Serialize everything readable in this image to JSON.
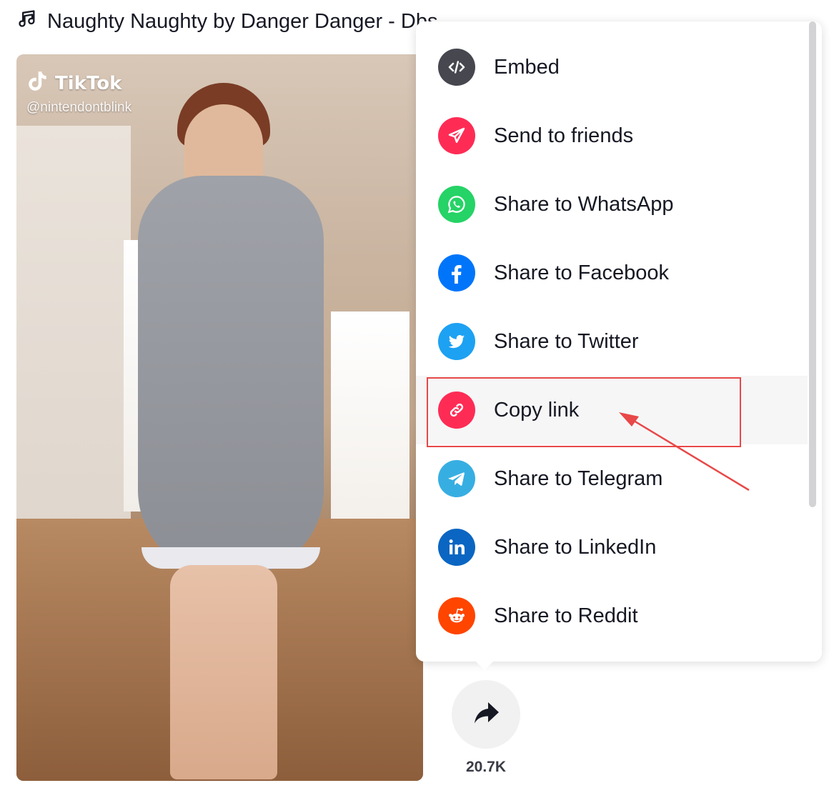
{
  "music": {
    "icon": "music-note-icon",
    "title": "Naughty Naughty by Danger Danger - Dbs"
  },
  "video": {
    "brand_name": "TikTok",
    "handle": "@nintendontblink"
  },
  "share_menu": {
    "items": [
      {
        "label": "Embed",
        "icon": "embed-icon",
        "color": "#46474f"
      },
      {
        "label": "Send to friends",
        "icon": "send-icon",
        "color": "#fe2c55"
      },
      {
        "label": "Share to WhatsApp",
        "icon": "whatsapp-icon",
        "color": "#25d366"
      },
      {
        "label": "Share to Facebook",
        "icon": "facebook-icon",
        "color": "#0075fa"
      },
      {
        "label": "Share to Twitter",
        "icon": "twitter-icon",
        "color": "#1da1f2"
      },
      {
        "label": "Copy link",
        "icon": "link-icon",
        "color": "#fe2c55"
      },
      {
        "label": "Share to Telegram",
        "icon": "telegram-icon",
        "color": "#37aee2"
      },
      {
        "label": "Share to LinkedIn",
        "icon": "linkedin-icon",
        "color": "#0a66c2"
      },
      {
        "label": "Share to Reddit",
        "icon": "reddit-icon",
        "color": "#ff4500"
      }
    ],
    "highlighted_item": "Copy link"
  },
  "share_button": {
    "icon": "share-arrow-icon",
    "count": "20.7K"
  },
  "annotation": {
    "color": "#e84848"
  }
}
